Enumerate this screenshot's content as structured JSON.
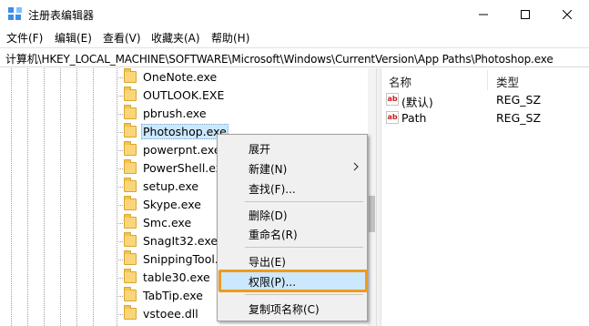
{
  "window": {
    "title": "注册表编辑器",
    "controls": {
      "minimize": "minimize-icon",
      "maximize": "maximize-icon",
      "close": "close-icon"
    }
  },
  "menu": {
    "items": [
      {
        "label": "文件(F)"
      },
      {
        "label": "编辑(E)"
      },
      {
        "label": "查看(V)"
      },
      {
        "label": "收藏夹(A)"
      },
      {
        "label": "帮助(H)"
      }
    ]
  },
  "address": {
    "path": "计算机\\HKEY_LOCAL_MACHINE\\SOFTWARE\\Microsoft\\Windows\\CurrentVersion\\App Paths\\Photoshop.exe"
  },
  "tree": {
    "items": [
      {
        "label": "OneNote.exe",
        "selected": false
      },
      {
        "label": "OUTLOOK.EXE",
        "selected": false
      },
      {
        "label": "pbrush.exe",
        "selected": false
      },
      {
        "label": "Photoshop.exe",
        "selected": true
      },
      {
        "label": "powerpnt.exe",
        "selected": false
      },
      {
        "label": "PowerShell.exe",
        "selected": false
      },
      {
        "label": "setup.exe",
        "selected": false
      },
      {
        "label": "Skype.exe",
        "selected": false
      },
      {
        "label": "Smc.exe",
        "selected": false
      },
      {
        "label": "SnagIt32.exe",
        "selected": false
      },
      {
        "label": "SnippingTool.exe",
        "selected": false
      },
      {
        "label": "table30.exe",
        "selected": false
      },
      {
        "label": "TabTip.exe",
        "selected": false
      },
      {
        "label": "vstoee.dll",
        "selected": false
      }
    ]
  },
  "values": {
    "headers": {
      "name": "名称",
      "type": "类型"
    },
    "rows": [
      {
        "name": "(默认)",
        "type": "REG_SZ",
        "icon": "string-value-icon"
      },
      {
        "name": "Path",
        "type": "REG_SZ",
        "icon": "string-value-icon"
      }
    ]
  },
  "context_menu": {
    "expand": "展开",
    "new": "新建(N)",
    "find": "查找(F)...",
    "delete": "删除(D)",
    "rename": "重命名(R)",
    "export": "导出(E)",
    "permissions": "权限(P)...",
    "copy_key_name": "复制项名称(C)"
  },
  "colors": {
    "selection": "#cce8ff",
    "highlight_border": "#f19a1c",
    "folder": "#fbd57a"
  }
}
